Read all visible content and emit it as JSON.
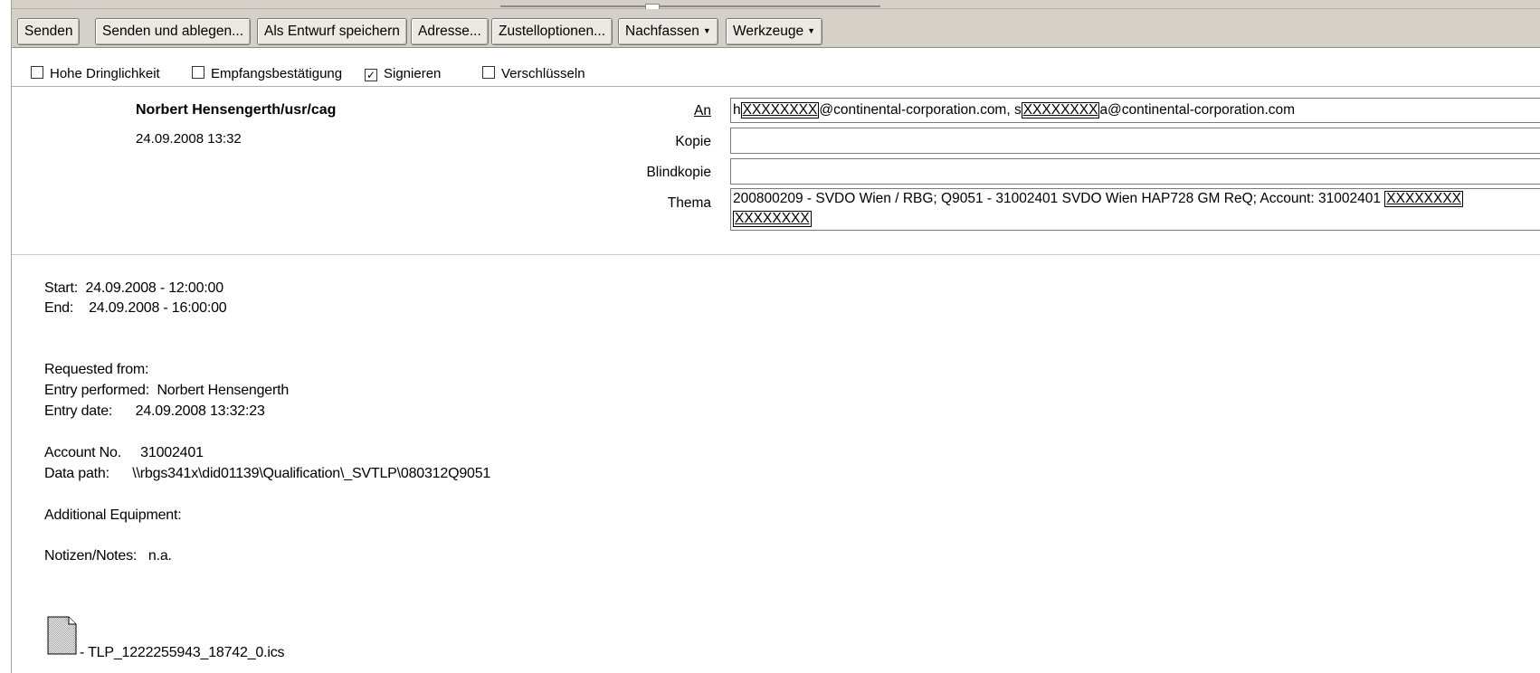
{
  "toolbar": {
    "buttons": [
      {
        "label": "Senden"
      },
      {
        "label": "Senden und ablegen..."
      },
      {
        "label": "Als Entwurf speichern"
      },
      {
        "label": "Adresse..."
      },
      {
        "label": "Zustelloptionen..."
      },
      {
        "label": "Nachfassen"
      },
      {
        "label": "Werkzeuge"
      }
    ],
    "dropdown_arrow": "▼"
  },
  "options": {
    "high_priority": {
      "label": "Hohe Dringlichkeit",
      "checked": false
    },
    "return_receipt": {
      "label": "Empfangsbestätigung",
      "checked": false
    },
    "sign": {
      "label": "Signieren",
      "checked": true,
      "mark": "✓"
    },
    "encrypt": {
      "label": "Verschlüsseln",
      "checked": false
    }
  },
  "header": {
    "sender": "Norbert Hensengerth/usr/cag",
    "date": "24.09.2008 13:32",
    "to_label": "An",
    "cc_label": "Kopie",
    "bcc_label": "Blindkopie",
    "subject_label": "Thema",
    "to": {
      "p1": "h",
      "r1": "XXXXXXXX",
      "p2": "@continental-corporation.com, s",
      "r2": "XXXXXXXX",
      "p3": "a@continental-corporation.com"
    },
    "cc": "",
    "bcc": "",
    "subject": {
      "line1": "200800209  -  SVDO Wien / RBG; Q9051 - 31002401  SVDO Wien HAP728 GM ReQ; Account: 31002401 ",
      "r1": "XXXXXXXX",
      "r2": "XXXXXXXX"
    }
  },
  "body": {
    "start": "Start:  24.09.2008 - 12:00:00",
    "end": "End:    24.09.2008 - 16:00:00",
    "requested_from": "Requested from:",
    "entry_performed": "Entry performed:  Norbert Hensengerth",
    "entry_date": "Entry date:      24.09.2008 13:32:23",
    "account_no": "Account No.     31002401",
    "data_path": "Data path:      \\\\rbgs341x\\did01139\\Qualification\\_SVTLP\\080312Q9051",
    "additional_equipment": "Additional Equipment:",
    "notes": "Notizen/Notes:   n.a.",
    "attachment": "- TLP_1222255943_18742_0.ics"
  }
}
